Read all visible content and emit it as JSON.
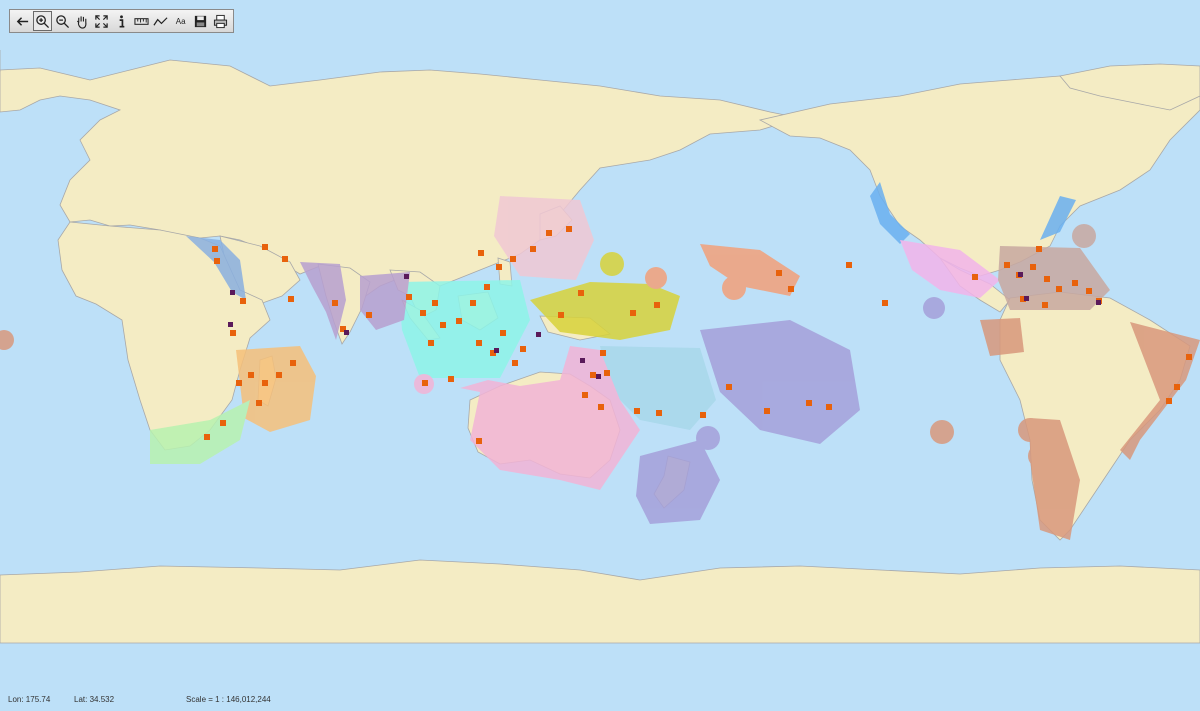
{
  "toolbar": {
    "tools": [
      {
        "name": "back-icon"
      },
      {
        "name": "zoom-in-icon",
        "active": true
      },
      {
        "name": "zoom-out-icon"
      },
      {
        "name": "pan-hand-icon"
      },
      {
        "name": "full-extent-icon"
      },
      {
        "name": "info-icon"
      },
      {
        "name": "measure-icon"
      },
      {
        "name": "profile-line-icon"
      },
      {
        "name": "label-text-icon",
        "label": "Aa"
      },
      {
        "name": "save-icon"
      },
      {
        "name": "print-icon"
      }
    ]
  },
  "status": {
    "lon": "Lon: 175.74",
    "lat": "Lat: 34.532",
    "scale": "Scale = 1 : 146,012,244"
  },
  "colors": {
    "ocean": "#bde0f8",
    "land": "#f4ecc4",
    "border": "#a8a8a8",
    "point_orange": "#e8620c",
    "point_purple": "#5a1a5a"
  }
}
